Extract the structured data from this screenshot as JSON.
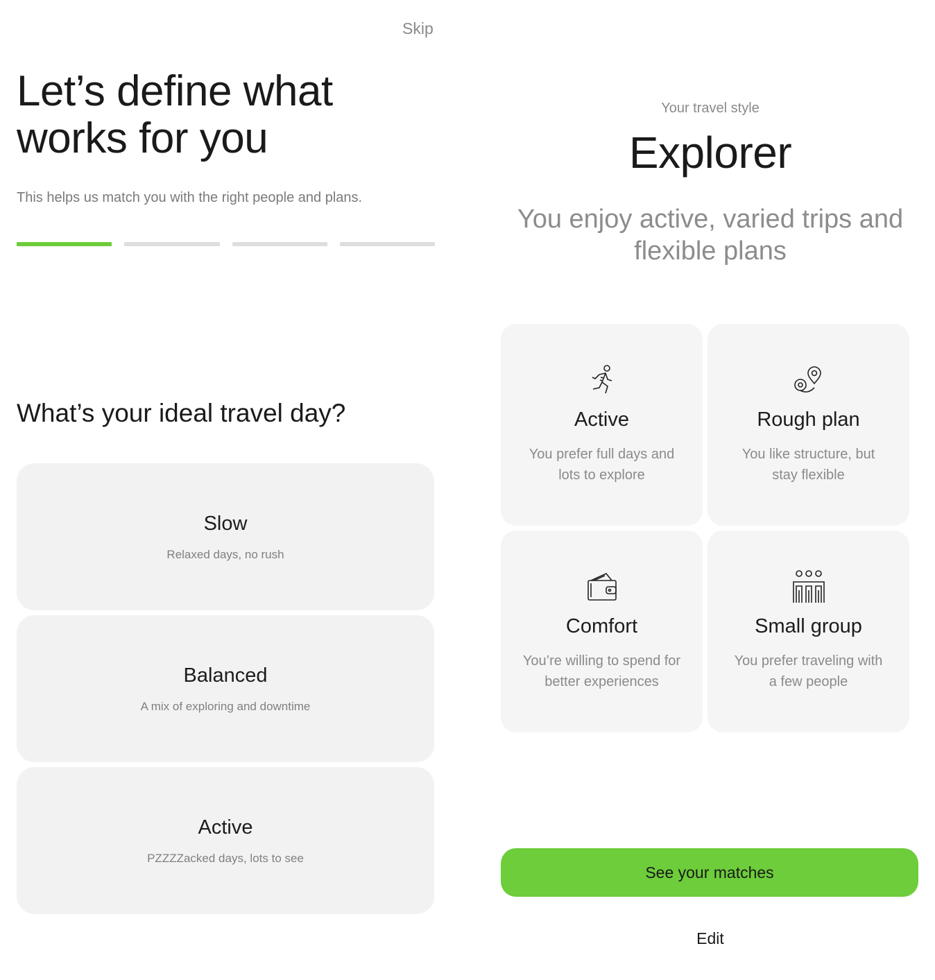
{
  "onboarding": {
    "skip_label": "Skip",
    "headline": "Let’s define what works for you",
    "subtext": "This helps us match you with the right people and plans.",
    "progress": {
      "current_step": 1,
      "total_steps": 4
    },
    "question": "What’s your ideal travel day?",
    "options": [
      {
        "title": "Slow",
        "description": "Relaxed days, no rush"
      },
      {
        "title": "Balanced",
        "description": "A mix of exploring and downtime"
      },
      {
        "title": "Active",
        "description": "PZZZZacked days, lots to see"
      }
    ]
  },
  "result": {
    "eyebrow": "Your travel style",
    "style_name": "Explorer",
    "style_description": "You enjoy active, varied trips and flexible plans",
    "traits": [
      {
        "icon": "running-person-icon",
        "title": "Active",
        "description": "You prefer full days and lots to explore"
      },
      {
        "icon": "route-pin-icon",
        "title": "Rough plan",
        "description": "You like structure, but stay flexible"
      },
      {
        "icon": "wallet-icon",
        "title": "Comfort",
        "description": "You’re willing to spend for better experiences"
      },
      {
        "icon": "group-people-icon",
        "title": "Small group",
        "description": "You prefer traveling with a few people"
      }
    ],
    "cta_label": "See your matches",
    "edit_label": "Edit"
  },
  "colors": {
    "accent": "#6dcd3a",
    "card_bg": "#f2f2f2",
    "muted_text": "#8a8a8a"
  }
}
